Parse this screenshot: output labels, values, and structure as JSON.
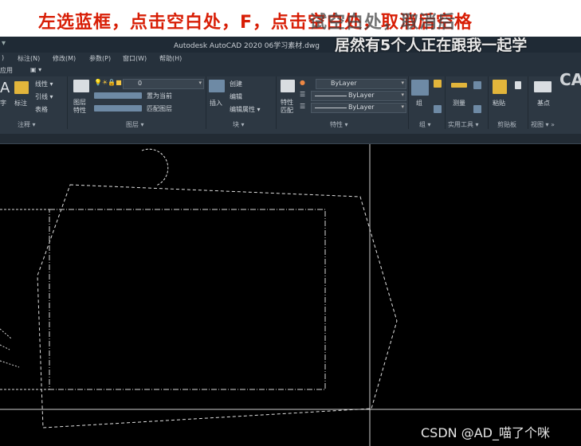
{
  "captions": {
    "instruction_red": "左选蓝框，点击空白处，F，点击空白处，取消后空格",
    "instruction_overlay": "试空白处，取消后",
    "viewers": "居然有5个人正在跟我一起学",
    "corner": "CA",
    "watermark": "CSDN @AD_喵了个咪"
  },
  "window": {
    "title": "Autodesk AutoCAD 2020   06学习素材.dwg",
    "menu_toggle": "▾"
  },
  "menu": {
    "items": [
      "标注(N)",
      "修改(M)",
      "参数(P)",
      "窗口(W)",
      "帮助(H)"
    ],
    "left_stub": ")"
  },
  "tabs": {
    "current": "应用",
    "extra": "▣ ▾"
  },
  "ribbon": {
    "annotation": {
      "text_btn": "字",
      "dim_btn": "标注",
      "linear": "线性 ▾",
      "leader": "引线 ▾",
      "table": "表格",
      "panel": "注释 ▾"
    },
    "layers": {
      "props_btn": "图层特性",
      "layer_value": "0",
      "set_current": "置为当前",
      "match": "匹配图层",
      "panel": "图层 ▾"
    },
    "block": {
      "insert": "插入",
      "create": "创建",
      "edit": "编辑",
      "edit_attr": "编辑属性 ▾",
      "panel": "块 ▾"
    },
    "properties": {
      "match_btn": "特性匹配",
      "color": "ByLayer",
      "linetype": "ByLayer",
      "lineweight": "ByLayer",
      "panel": "特性 ▾"
    },
    "groups": {
      "btn": "组",
      "panel": "组 ▾"
    },
    "utilities": {
      "measure": "测量",
      "panel": "实用工具 ▾"
    },
    "clipboard": {
      "paste": "粘贴",
      "panel": "剪贴板"
    },
    "view": {
      "base": "基点",
      "panel": "视图 ▾ »"
    }
  },
  "colors": {
    "ribbon_bg": "#2d3843",
    "caption_red": "#d81e06",
    "cad_bg": "#000000",
    "selection_dash": "#e0e0e0"
  }
}
